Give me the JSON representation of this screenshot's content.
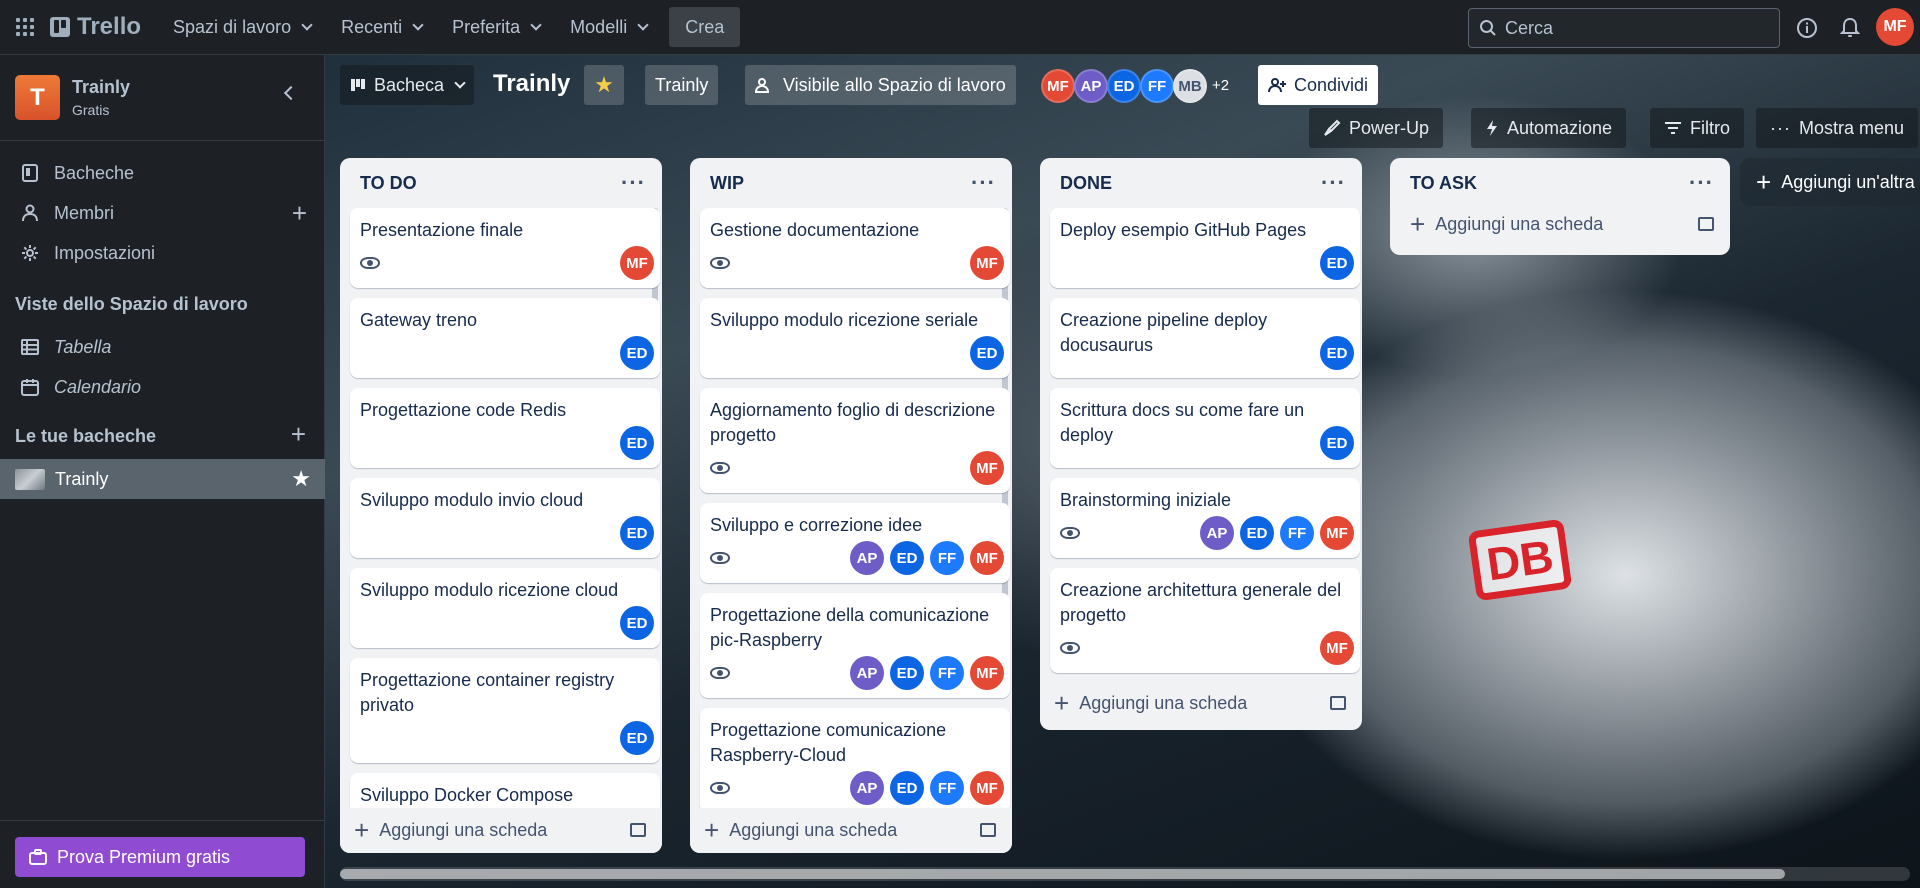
{
  "header": {
    "logo": "Trello",
    "nav": [
      {
        "label": "Spazi di lavoro"
      },
      {
        "label": "Recenti"
      },
      {
        "label": "Preferita"
      },
      {
        "label": "Modelli"
      }
    ],
    "create_label": "Crea",
    "search_placeholder": "Cerca",
    "user_initials": "MF"
  },
  "sidebar": {
    "workspace_initial": "T",
    "workspace_name": "Trainly",
    "workspace_plan": "Gratis",
    "items": [
      {
        "label": "Bacheche",
        "icon": "board-icon"
      },
      {
        "label": "Membri",
        "icon": "person-icon"
      },
      {
        "label": "Impostazioni",
        "icon": "gear-icon"
      }
    ],
    "views_heading": "Viste dello Spazio di lavoro",
    "views": [
      {
        "label": "Tabella",
        "icon": "table-icon"
      },
      {
        "label": "Calendario",
        "icon": "calendar-icon"
      }
    ],
    "boards_heading": "Le tue bacheche",
    "boards": [
      {
        "label": "Trainly"
      }
    ],
    "premium_label": "Prova Premium gratis"
  },
  "board": {
    "view_label": "Bacheca",
    "title": "Trainly",
    "workspace_chip": "Trainly",
    "visibility_label": "Visibile allo Spazio di lavoro",
    "members": [
      "MF",
      "AP",
      "ED",
      "FF",
      "MB"
    ],
    "members_more": "+2",
    "share_label": "Condividi",
    "powerup_label": "Power-Up",
    "automation_label": "Automazione",
    "filter_label": "Filtro",
    "menu_label": "Mostra menu",
    "add_list_label": "Aggiungi un'altra",
    "add_card_label": "Aggiungi una scheda",
    "lists": [
      {
        "title": "TO DO",
        "cards": [
          {
            "title": "Presentazione finale",
            "watch": true,
            "members": [
              "MF"
            ]
          },
          {
            "title": "Gateway treno",
            "watch": false,
            "members": [
              "ED"
            ]
          },
          {
            "title": "Progettazione code Redis",
            "watch": false,
            "members": [
              "ED"
            ]
          },
          {
            "title": "Sviluppo modulo invio cloud",
            "watch": false,
            "members": [
              "ED"
            ]
          },
          {
            "title": "Sviluppo modulo ricezione cloud",
            "watch": false,
            "members": [
              "ED"
            ]
          },
          {
            "title": "Progettazione container registry privato",
            "watch": false,
            "members": [
              "ED"
            ]
          },
          {
            "title": "Sviluppo Docker Compose",
            "watch": false,
            "members": []
          }
        ]
      },
      {
        "title": "WIP",
        "cards": [
          {
            "title": "Gestione documentazione",
            "watch": true,
            "members": [
              "MF"
            ]
          },
          {
            "title": "Sviluppo modulo ricezione seriale",
            "watch": false,
            "members": [
              "ED"
            ]
          },
          {
            "title": "Aggiornamento foglio di descrizione progetto",
            "watch": true,
            "members": [
              "MF"
            ]
          },
          {
            "title": "Sviluppo e correzione idee",
            "watch": true,
            "members": [
              "AP",
              "ED",
              "FF",
              "MF"
            ]
          },
          {
            "title": "Progettazione della comunicazione pic-Raspberry",
            "watch": true,
            "members": [
              "AP",
              "ED",
              "FF",
              "MF"
            ]
          },
          {
            "title": "Progettazione comunicazione Raspberry-Cloud",
            "watch": true,
            "members": [
              "AP",
              "ED",
              "FF",
              "MF"
            ]
          }
        ]
      },
      {
        "title": "DONE",
        "cards": [
          {
            "title": "Deploy esempio GitHub Pages",
            "watch": false,
            "members": [
              "ED"
            ]
          },
          {
            "title": "Creazione pipeline deploy docusaurus",
            "watch": false,
            "members": [
              "ED"
            ]
          },
          {
            "title": "Scrittura docs su come fare un deploy",
            "watch": false,
            "members": [
              "ED"
            ]
          },
          {
            "title": "Brainstorming iniziale",
            "watch": true,
            "members": [
              "AP",
              "ED",
              "FF",
              "MF"
            ]
          },
          {
            "title": "Creazione architettura generale del progetto",
            "watch": true,
            "members": [
              "MF"
            ]
          }
        ]
      },
      {
        "title": "TO ASK",
        "cards": []
      }
    ]
  },
  "background_logo": "DB",
  "colors": {
    "avatar_MF": "#e34935",
    "avatar_ED": "#0c66e4",
    "avatar_AP": "#6e5dc6",
    "avatar_FF": "#1d7afc",
    "premium": "#8f4cd3"
  }
}
